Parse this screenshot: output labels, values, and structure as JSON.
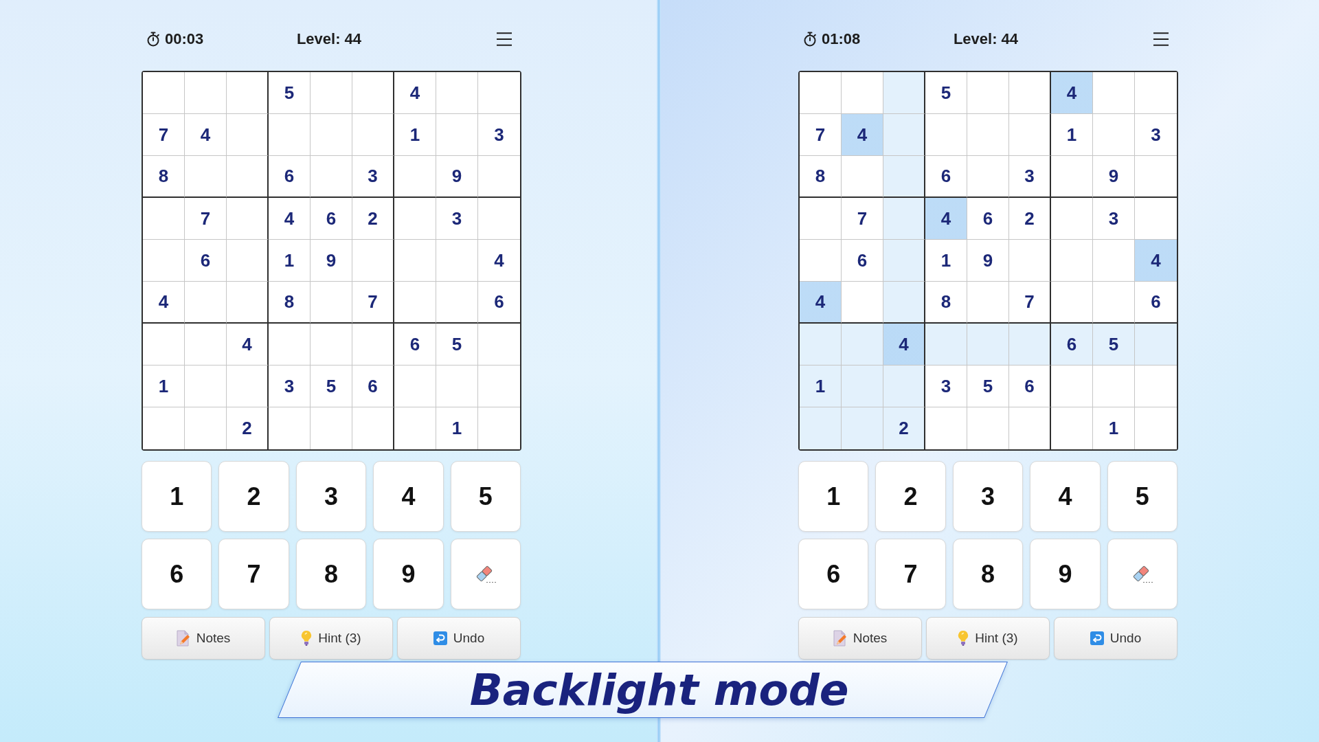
{
  "panels": [
    {
      "timer": "00:03",
      "level_label": "Level: 44",
      "grid": [
        [
          {
            "highlighted": false,
            "same_digit": false
          },
          {
            "highlighted": false,
            "same_digit": false
          },
          {
            "highlighted": false,
            "same_digit": false
          },
          {
            "value": "5",
            "highlighted": false,
            "same_digit": false
          },
          {
            "highlighted": false,
            "same_digit": false
          },
          {
            "highlighted": false,
            "same_digit": false
          },
          {
            "value": "4",
            "highlighted": false,
            "same_digit": false
          },
          {
            "highlighted": false,
            "same_digit": false
          },
          {
            "highlighted": false,
            "same_digit": false
          }
        ],
        [
          {
            "value": "7",
            "highlighted": false,
            "same_digit": false
          },
          {
            "value": "4",
            "highlighted": false,
            "same_digit": false
          },
          {
            "highlighted": false,
            "same_digit": false
          },
          {
            "highlighted": false,
            "same_digit": false
          },
          {
            "highlighted": false,
            "same_digit": false
          },
          {
            "highlighted": false,
            "same_digit": false
          },
          {
            "value": "1",
            "highlighted": false,
            "same_digit": false
          },
          {
            "highlighted": false,
            "same_digit": false
          },
          {
            "value": "3",
            "highlighted": false,
            "same_digit": false
          }
        ],
        [
          {
            "value": "8",
            "highlighted": false,
            "same_digit": false
          },
          {
            "highlighted": false,
            "same_digit": false
          },
          {
            "highlighted": false,
            "same_digit": false
          },
          {
            "value": "6",
            "highlighted": false,
            "same_digit": false
          },
          {
            "highlighted": false,
            "same_digit": false
          },
          {
            "value": "3",
            "highlighted": false,
            "same_digit": false
          },
          {
            "highlighted": false,
            "same_digit": false
          },
          {
            "value": "9",
            "highlighted": false,
            "same_digit": false
          },
          {
            "highlighted": false,
            "same_digit": false
          }
        ],
        [
          {
            "highlighted": false,
            "same_digit": false
          },
          {
            "value": "7",
            "highlighted": false,
            "same_digit": false
          },
          {
            "highlighted": false,
            "same_digit": false
          },
          {
            "value": "4",
            "highlighted": false,
            "same_digit": false
          },
          {
            "value": "6",
            "highlighted": false,
            "same_digit": false
          },
          {
            "value": "2",
            "highlighted": false,
            "same_digit": false
          },
          {
            "highlighted": false,
            "same_digit": false
          },
          {
            "value": "3",
            "highlighted": false,
            "same_digit": false
          },
          {
            "highlighted": false,
            "same_digit": false
          }
        ],
        [
          {
            "highlighted": false,
            "same_digit": false
          },
          {
            "value": "6",
            "highlighted": false,
            "same_digit": false
          },
          {
            "highlighted": false,
            "same_digit": false
          },
          {
            "value": "1",
            "highlighted": false,
            "same_digit": false
          },
          {
            "value": "9",
            "highlighted": false,
            "same_digit": false
          },
          {
            "highlighted": false,
            "same_digit": false
          },
          {
            "highlighted": false,
            "same_digit": false
          },
          {
            "highlighted": false,
            "same_digit": false
          },
          {
            "value": "4",
            "highlighted": false,
            "same_digit": false
          }
        ],
        [
          {
            "value": "4",
            "highlighted": false,
            "same_digit": false
          },
          {
            "highlighted": false,
            "same_digit": false
          },
          {
            "highlighted": false,
            "same_digit": false
          },
          {
            "value": "8",
            "highlighted": false,
            "same_digit": false
          },
          {
            "highlighted": false,
            "same_digit": false
          },
          {
            "value": "7",
            "highlighted": false,
            "same_digit": false
          },
          {
            "highlighted": false,
            "same_digit": false
          },
          {
            "highlighted": false,
            "same_digit": false
          },
          {
            "value": "6",
            "highlighted": false,
            "same_digit": false
          }
        ],
        [
          {
            "highlighted": false,
            "same_digit": false
          },
          {
            "highlighted": false,
            "same_digit": false
          },
          {
            "value": "4",
            "highlighted": false,
            "same_digit": false
          },
          {
            "highlighted": false,
            "same_digit": false
          },
          {
            "highlighted": false,
            "same_digit": false
          },
          {
            "highlighted": false,
            "same_digit": false
          },
          {
            "value": "6",
            "highlighted": false,
            "same_digit": false
          },
          {
            "value": "5",
            "highlighted": false,
            "same_digit": false
          },
          {
            "highlighted": false,
            "same_digit": false
          }
        ],
        [
          {
            "value": "1",
            "highlighted": false,
            "same_digit": false
          },
          {
            "highlighted": false,
            "same_digit": false
          },
          {
            "highlighted": false,
            "same_digit": false
          },
          {
            "value": "3",
            "highlighted": false,
            "same_digit": false
          },
          {
            "value": "5",
            "highlighted": false,
            "same_digit": false
          },
          {
            "value": "6",
            "highlighted": false,
            "same_digit": false
          },
          {
            "highlighted": false,
            "same_digit": false
          },
          {
            "highlighted": false,
            "same_digit": false
          },
          {
            "highlighted": false,
            "same_digit": false
          }
        ],
        [
          {
            "highlighted": false,
            "same_digit": false
          },
          {
            "highlighted": false,
            "same_digit": false
          },
          {
            "value": "2",
            "highlighted": false,
            "same_digit": false
          },
          {
            "highlighted": false,
            "same_digit": false
          },
          {
            "highlighted": false,
            "same_digit": false
          },
          {
            "highlighted": false,
            "same_digit": false
          },
          {
            "highlighted": false,
            "same_digit": false
          },
          {
            "value": "1",
            "highlighted": false,
            "same_digit": false
          },
          {
            "highlighted": false,
            "same_digit": false
          }
        ]
      ],
      "keypad": [
        {
          "kind": "digit",
          "label": "1"
        },
        {
          "kind": "digit",
          "label": "2"
        },
        {
          "kind": "digit",
          "label": "3"
        },
        {
          "kind": "digit",
          "label": "4"
        },
        {
          "kind": "digit",
          "label": "5"
        },
        {
          "kind": "digit",
          "label": "6"
        },
        {
          "kind": "digit",
          "label": "7"
        },
        {
          "kind": "digit",
          "label": "8"
        },
        {
          "kind": "digit",
          "label": "9"
        },
        {
          "kind": "eraser"
        }
      ],
      "actions": [
        {
          "kind": "notes",
          "label": "Notes"
        },
        {
          "kind": "hint",
          "label": "Hint (3)"
        },
        {
          "kind": "undo",
          "label": "Undo"
        }
      ]
    },
    {
      "timer": "01:08",
      "level_label": "Level: 44",
      "grid": [
        [
          {
            "highlighted": false,
            "same_digit": false
          },
          {
            "highlighted": false,
            "same_digit": false
          },
          {
            "highlighted": true,
            "same_digit": false
          },
          {
            "value": "5",
            "highlighted": false,
            "same_digit": false
          },
          {
            "highlighted": false,
            "same_digit": false
          },
          {
            "highlighted": false,
            "same_digit": false
          },
          {
            "value": "4",
            "highlighted": false,
            "same_digit": true
          },
          {
            "highlighted": false,
            "same_digit": false
          },
          {
            "highlighted": false,
            "same_digit": false
          }
        ],
        [
          {
            "value": "7",
            "highlighted": false,
            "same_digit": false
          },
          {
            "value": "4",
            "highlighted": false,
            "same_digit": true
          },
          {
            "highlighted": true,
            "same_digit": false
          },
          {
            "highlighted": false,
            "same_digit": false
          },
          {
            "highlighted": false,
            "same_digit": false
          },
          {
            "highlighted": false,
            "same_digit": false
          },
          {
            "value": "1",
            "highlighted": false,
            "same_digit": false
          },
          {
            "highlighted": false,
            "same_digit": false
          },
          {
            "value": "3",
            "highlighted": false,
            "same_digit": false
          }
        ],
        [
          {
            "value": "8",
            "highlighted": false,
            "same_digit": false
          },
          {
            "highlighted": false,
            "same_digit": false
          },
          {
            "highlighted": true,
            "same_digit": false
          },
          {
            "value": "6",
            "highlighted": false,
            "same_digit": false
          },
          {
            "highlighted": false,
            "same_digit": false
          },
          {
            "value": "3",
            "highlighted": false,
            "same_digit": false
          },
          {
            "highlighted": false,
            "same_digit": false
          },
          {
            "value": "9",
            "highlighted": false,
            "same_digit": false
          },
          {
            "highlighted": false,
            "same_digit": false
          }
        ],
        [
          {
            "highlighted": false,
            "same_digit": false
          },
          {
            "value": "7",
            "highlighted": false,
            "same_digit": false
          },
          {
            "highlighted": true,
            "same_digit": false
          },
          {
            "value": "4",
            "highlighted": false,
            "same_digit": true
          },
          {
            "value": "6",
            "highlighted": false,
            "same_digit": false
          },
          {
            "value": "2",
            "highlighted": false,
            "same_digit": false
          },
          {
            "highlighted": false,
            "same_digit": false
          },
          {
            "value": "3",
            "highlighted": false,
            "same_digit": false
          },
          {
            "highlighted": false,
            "same_digit": false
          }
        ],
        [
          {
            "highlighted": false,
            "same_digit": false
          },
          {
            "value": "6",
            "highlighted": false,
            "same_digit": false
          },
          {
            "highlighted": true,
            "same_digit": false
          },
          {
            "value": "1",
            "highlighted": false,
            "same_digit": false
          },
          {
            "value": "9",
            "highlighted": false,
            "same_digit": false
          },
          {
            "highlighted": false,
            "same_digit": false
          },
          {
            "highlighted": false,
            "same_digit": false
          },
          {
            "highlighted": false,
            "same_digit": false
          },
          {
            "value": "4",
            "highlighted": false,
            "same_digit": true
          }
        ],
        [
          {
            "value": "4",
            "highlighted": false,
            "same_digit": true
          },
          {
            "highlighted": false,
            "same_digit": false
          },
          {
            "highlighted": true,
            "same_digit": false
          },
          {
            "value": "8",
            "highlighted": false,
            "same_digit": false
          },
          {
            "highlighted": false,
            "same_digit": false
          },
          {
            "value": "7",
            "highlighted": false,
            "same_digit": false
          },
          {
            "highlighted": false,
            "same_digit": false
          },
          {
            "highlighted": false,
            "same_digit": false
          },
          {
            "value": "6",
            "highlighted": false,
            "same_digit": false
          }
        ],
        [
          {
            "highlighted": true,
            "same_digit": false
          },
          {
            "highlighted": true,
            "same_digit": false
          },
          {
            "value": "4",
            "highlighted": true,
            "same_digit": true
          },
          {
            "highlighted": true,
            "same_digit": false
          },
          {
            "highlighted": true,
            "same_digit": false
          },
          {
            "highlighted": true,
            "same_digit": false
          },
          {
            "value": "6",
            "highlighted": true,
            "same_digit": false
          },
          {
            "value": "5",
            "highlighted": true,
            "same_digit": false
          },
          {
            "highlighted": true,
            "same_digit": false
          }
        ],
        [
          {
            "value": "1",
            "highlighted": true,
            "same_digit": false
          },
          {
            "highlighted": true,
            "same_digit": false
          },
          {
            "highlighted": true,
            "same_digit": false
          },
          {
            "value": "3",
            "highlighted": false,
            "same_digit": false
          },
          {
            "value": "5",
            "highlighted": false,
            "same_digit": false
          },
          {
            "value": "6",
            "highlighted": false,
            "same_digit": false
          },
          {
            "highlighted": false,
            "same_digit": false
          },
          {
            "highlighted": false,
            "same_digit": false
          },
          {
            "highlighted": false,
            "same_digit": false
          }
        ],
        [
          {
            "highlighted": true,
            "same_digit": false
          },
          {
            "highlighted": true,
            "same_digit": false
          },
          {
            "value": "2",
            "highlighted": true,
            "same_digit": false
          },
          {
            "highlighted": false,
            "same_digit": false
          },
          {
            "highlighted": false,
            "same_digit": false
          },
          {
            "highlighted": false,
            "same_digit": false
          },
          {
            "highlighted": false,
            "same_digit": false
          },
          {
            "value": "1",
            "highlighted": false,
            "same_digit": false
          },
          {
            "highlighted": false,
            "same_digit": false
          }
        ]
      ],
      "keypad": [
        {
          "kind": "digit",
          "label": "1"
        },
        {
          "kind": "digit",
          "label": "2"
        },
        {
          "kind": "digit",
          "label": "3"
        },
        {
          "kind": "digit",
          "label": "4"
        },
        {
          "kind": "digit",
          "label": "5"
        },
        {
          "kind": "digit",
          "label": "6"
        },
        {
          "kind": "digit",
          "label": "7"
        },
        {
          "kind": "digit",
          "label": "8"
        },
        {
          "kind": "digit",
          "label": "9"
        },
        {
          "kind": "eraser"
        }
      ],
      "actions": [
        {
          "kind": "notes",
          "label": "Notes"
        },
        {
          "kind": "hint",
          "label": "Hint (3)"
        },
        {
          "kind": "undo",
          "label": "Undo"
        }
      ]
    }
  ],
  "banner": {
    "title": "Backlight mode"
  }
}
